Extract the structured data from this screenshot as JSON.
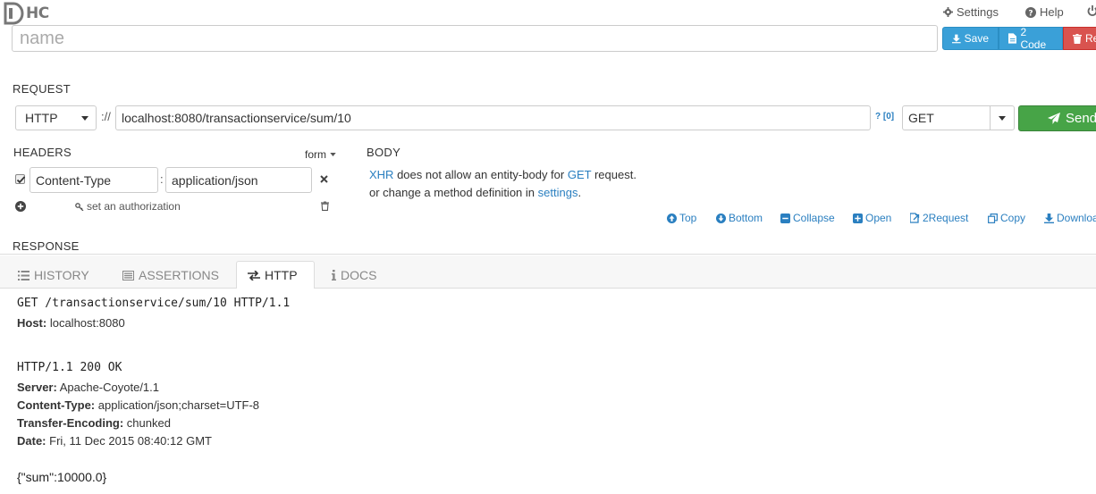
{
  "app": {
    "logo": "HC"
  },
  "nav": {
    "settings": "Settings",
    "help": "Help"
  },
  "request": {
    "name_placeholder": "name",
    "save_label": "Save",
    "code_label": "2 Code",
    "remove_label": "Re",
    "section_title": "REQUEST",
    "protocol": "HTTP",
    "scheme_sep": "://",
    "url": "localhost:8080/transactionservice/sum/10",
    "url_help": "? [0]",
    "method": "GET",
    "send_label": "Send"
  },
  "headers": {
    "title": "HEADERS",
    "form_toggle": "form",
    "items": [
      {
        "name": "Content-Type",
        "value": "application/json"
      }
    ],
    "separator": ":",
    "auth_label": "set an authorization"
  },
  "body": {
    "title": "BODY",
    "msg_xhr": "XHR",
    "msg_part1": " does not allow an entity-body for ",
    "msg_method": "GET",
    "msg_part2": " request.",
    "msg_line2_prefix": "or change a method definition in ",
    "msg_settings": "settings",
    "msg_line2_suffix": "."
  },
  "toolbar": {
    "top": "Top",
    "bottom": "Bottom",
    "collapse": "Collapse",
    "open": "Open",
    "to_request": "2Request",
    "copy": "Copy",
    "download": "Downloa"
  },
  "response": {
    "title": "RESPONSE"
  },
  "tabs": {
    "history": "HISTORY",
    "assertions": "ASSERTIONS",
    "http": "HTTP",
    "docs": "DOCS"
  },
  "http": {
    "request_line": "GET /transactionservice/sum/10 HTTP/1.1",
    "request_headers": [
      {
        "key": "Host:",
        "value": " localhost:8080"
      }
    ],
    "status_line": "HTTP/1.1 200 OK",
    "response_headers": [
      {
        "key": "Server:",
        "value": " Apache-Coyote/1.1"
      },
      {
        "key": "Content-Type:",
        "value": " application/json;charset=UTF-8"
      },
      {
        "key": "Transfer-Encoding:",
        "value": " chunked"
      },
      {
        "key": "Date:",
        "value": " Fri, 11 Dec 2015 08:40:12 GMT"
      }
    ],
    "body": "{\"sum\":10000.0}"
  },
  "colors": {
    "accent": "#2a7fc0",
    "save": "#3aa0d8",
    "remove": "#d9534f",
    "send": "#47a447"
  }
}
